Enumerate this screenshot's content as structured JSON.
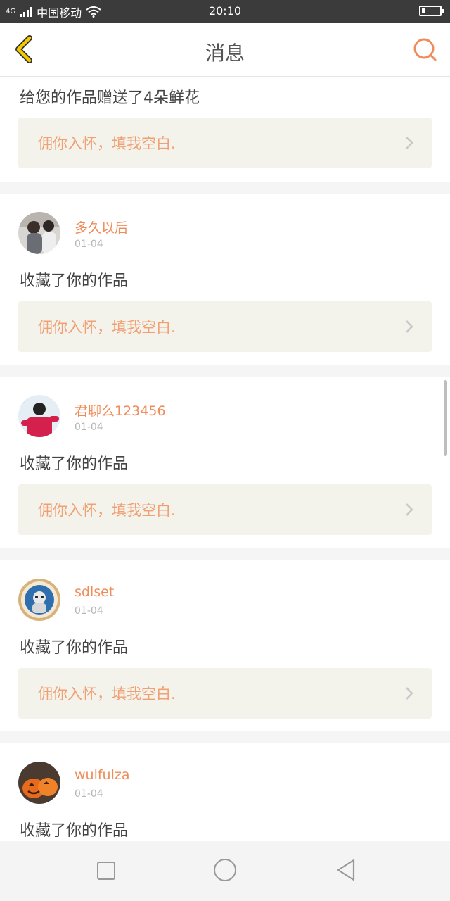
{
  "status_bar": {
    "network": "4G",
    "carrier": "中国移动",
    "time": "20:10"
  },
  "header": {
    "title": "消息",
    "back_icon": "chevron-left-icon",
    "search_icon": "search-icon"
  },
  "colors": {
    "accent": "#f08c5a",
    "quote_bg": "#f3f3ec",
    "quote_text": "#f0a072",
    "back_icon": "#f5c900"
  },
  "messages": [
    {
      "text": "给您的作品赠送了4朵鲜花",
      "quote": "佣你入怀，填我空白."
    },
    {
      "username": "多久以后",
      "date": "01-04",
      "text": "收藏了你的作品",
      "quote": "佣你入怀，填我空白."
    },
    {
      "username": "君聊么123456",
      "date": "01-04",
      "text": "收藏了你的作品",
      "quote": "佣你入怀，填我空白."
    },
    {
      "username": "sdlset",
      "date": "01-04",
      "text": "收藏了你的作品",
      "quote": "佣你入怀，填我空白."
    },
    {
      "username": "wulfulza",
      "date": "01-04",
      "text": "收藏了你的作品"
    }
  ],
  "bottom_nav": [
    "recent-apps-icon",
    "home-icon",
    "back-triangle-icon"
  ]
}
